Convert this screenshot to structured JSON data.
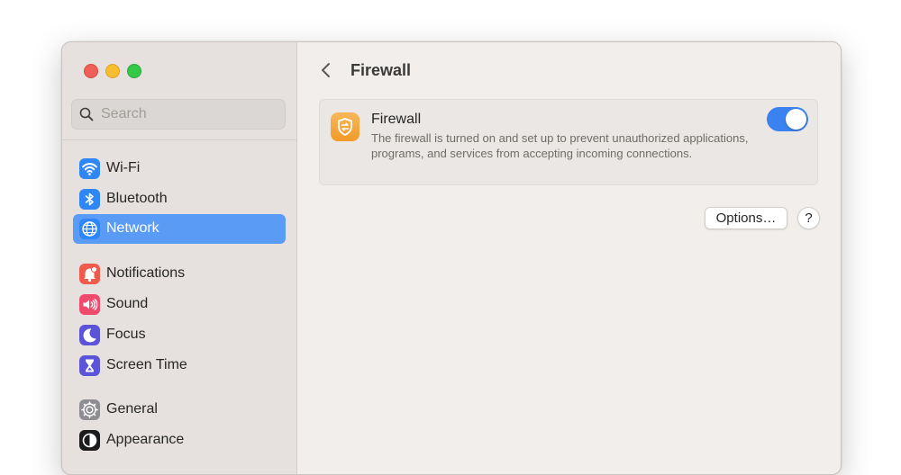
{
  "window": {
    "controls": [
      "close",
      "minimize",
      "zoom"
    ]
  },
  "sidebar": {
    "search": {
      "placeholder": "Search",
      "value": ""
    },
    "items": [
      {
        "label": "Wi-Fi",
        "icon": "wifi-icon",
        "color": "#2f86f5",
        "active": false
      },
      {
        "label": "Bluetooth",
        "icon": "bluetooth-icon",
        "color": "#2f86f5",
        "active": false
      },
      {
        "label": "Network",
        "icon": "globe-icon",
        "color": "#2f86f5",
        "active": true
      },
      {
        "label": "Notifications",
        "icon": "bell-badge-icon",
        "color": "#ef5a4d",
        "active": false
      },
      {
        "label": "Sound",
        "icon": "speaker-icon",
        "color": "#ef4a6b",
        "active": false
      },
      {
        "label": "Focus",
        "icon": "moon-icon",
        "color": "#5b54d8",
        "active": false
      },
      {
        "label": "Screen Time",
        "icon": "hourglass-icon",
        "color": "#5b54d8",
        "active": false
      },
      {
        "label": "General",
        "icon": "gear-icon",
        "color": "#8e8e92",
        "active": false
      },
      {
        "label": "Appearance",
        "icon": "appearance-icon",
        "color": "#1c1c1e",
        "active": false
      }
    ]
  },
  "main": {
    "back_icon": "chevron-left-icon",
    "title": "Firewall",
    "firewall": {
      "title": "Firewall",
      "description": "The firewall is turned on and set up to prevent unauthorized applications, programs, and services from accepting incoming connections.",
      "icon": "firewall-icon",
      "enabled": true
    },
    "options_label": "Options…",
    "help_label": "?"
  },
  "colors": {
    "accent": "#3b82f0",
    "selection": "#5a9bf5",
    "firewall_icon": "#f4a73a"
  }
}
